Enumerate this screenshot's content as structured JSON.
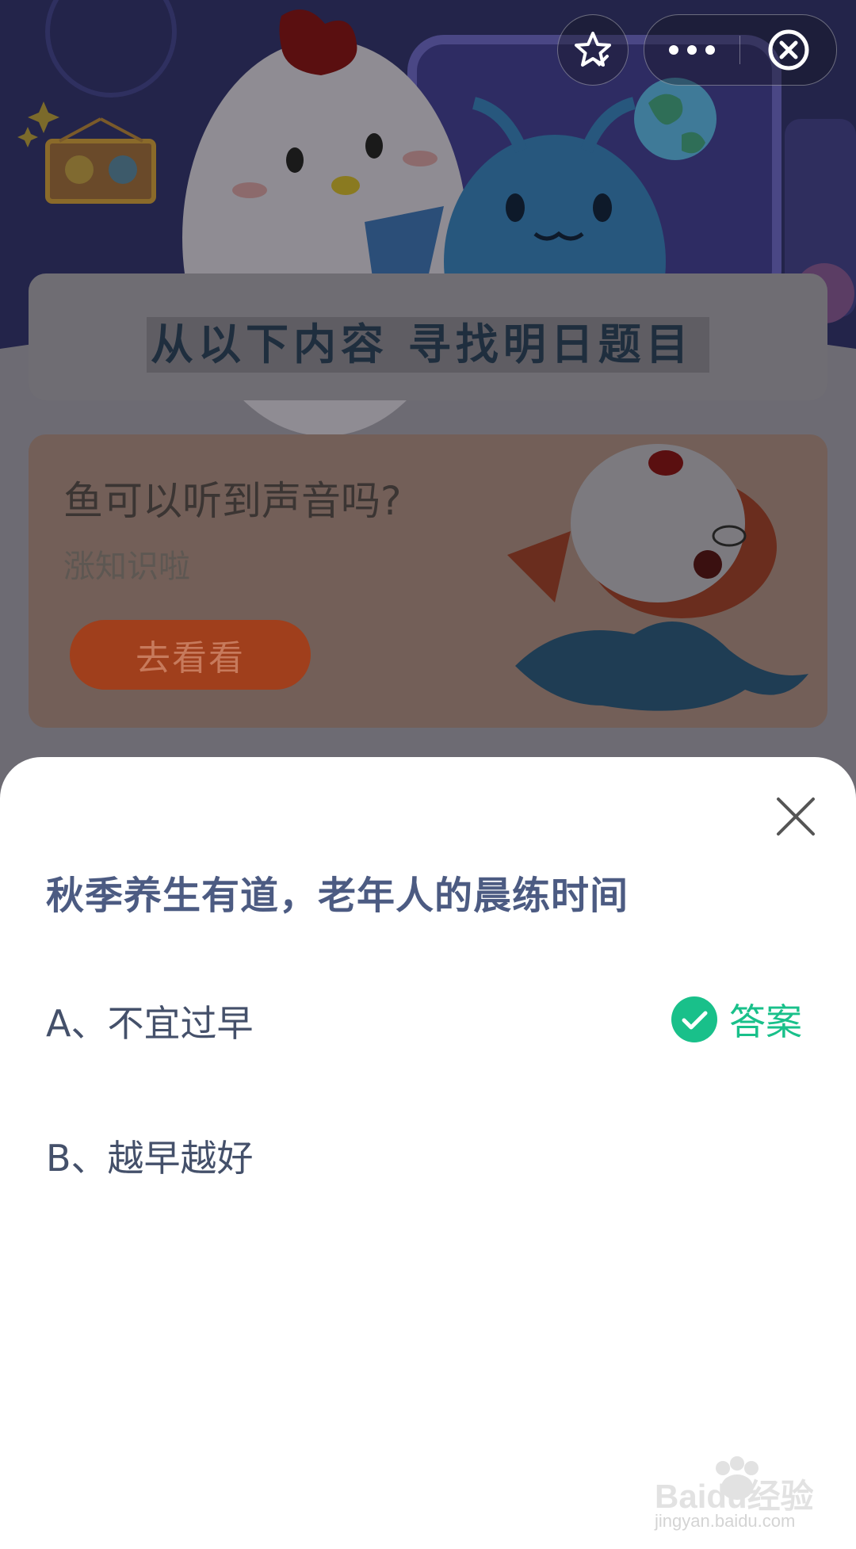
{
  "top_controls": {
    "favorite_icon": "star-check-icon",
    "more_icon": "more-dots-icon",
    "close_icon": "close-circle-icon"
  },
  "banner": {
    "title": "从以下内容  寻找明日题目"
  },
  "card": {
    "title": "鱼可以听到声音吗?",
    "subtitle": "涨知识啦",
    "button_label": "去看看"
  },
  "quiz": {
    "question": "秋季养生有道，老年人的晨练时间",
    "options": [
      {
        "label": "A、不宜过早",
        "is_answer": true
      },
      {
        "label": "B、越早越好",
        "is_answer": false
      }
    ],
    "answer_label": "答案",
    "close_icon": "close-x-icon"
  },
  "colors": {
    "accent_green": "#19c08a",
    "question_color": "#4c5b82",
    "button_color": "#a03f1c"
  },
  "watermark": {
    "brand": "Baidu经验",
    "url": "jingyan.baidu.com"
  }
}
